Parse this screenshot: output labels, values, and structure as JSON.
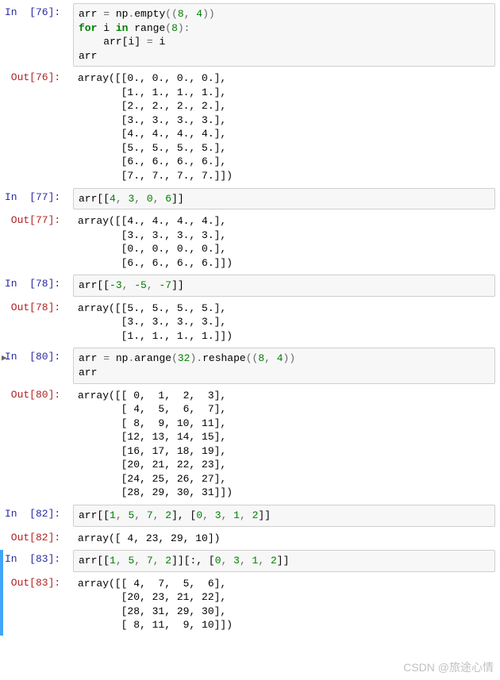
{
  "cells": {
    "c76": {
      "in_label": "In  [76]: ",
      "out_label": "Out[76]: ",
      "code_tokens": [
        [
          "arr ",
          "n"
        ],
        [
          "= ",
          "o"
        ],
        [
          "np",
          "n"
        ],
        [
          ".",
          "o"
        ],
        [
          "empty",
          "fn"
        ],
        [
          "((",
          "o"
        ],
        [
          "8",
          "num"
        ],
        [
          ", ",
          "o"
        ],
        [
          "4",
          "num"
        ],
        [
          "))",
          "o"
        ],
        [
          "\n",
          ""
        ],
        [
          "for ",
          "k"
        ],
        [
          "i ",
          "n"
        ],
        [
          "in ",
          "k"
        ],
        [
          "range",
          "fn"
        ],
        [
          "(",
          "o"
        ],
        [
          "8",
          "num"
        ],
        [
          "):",
          "o"
        ],
        [
          "\n",
          ""
        ],
        [
          "    arr[i] ",
          "n"
        ],
        [
          "= ",
          "o"
        ],
        [
          "i",
          "n"
        ],
        [
          "\n",
          ""
        ],
        [
          "arr",
          "n"
        ]
      ],
      "output": "array([[0., 0., 0., 0.],\n       [1., 1., 1., 1.],\n       [2., 2., 2., 2.],\n       [3., 3., 3., 3.],\n       [4., 4., 4., 4.],\n       [5., 5., 5., 5.],\n       [6., 6., 6., 6.],\n       [7., 7., 7., 7.]])"
    },
    "c77": {
      "in_label": "In  [77]: ",
      "out_label": "Out[77]: ",
      "code_tokens": [
        [
          "arr[[",
          "n"
        ],
        [
          "4",
          "num"
        ],
        [
          ", ",
          "o"
        ],
        [
          "3",
          "num"
        ],
        [
          ", ",
          "o"
        ],
        [
          "0",
          "num"
        ],
        [
          ", ",
          "o"
        ],
        [
          "6",
          "num"
        ],
        [
          "]]",
          "n"
        ]
      ],
      "output": "array([[4., 4., 4., 4.],\n       [3., 3., 3., 3.],\n       [0., 0., 0., 0.],\n       [6., 6., 6., 6.]])"
    },
    "c78": {
      "in_label": "In  [78]: ",
      "out_label": "Out[78]: ",
      "code_tokens": [
        [
          "arr[[",
          "n"
        ],
        [
          "-3",
          "num"
        ],
        [
          ", ",
          "o"
        ],
        [
          "-5",
          "num"
        ],
        [
          ", ",
          "o"
        ],
        [
          "-7",
          "num"
        ],
        [
          "]]",
          "n"
        ]
      ],
      "output": "array([[5., 5., 5., 5.],\n       [3., 3., 3., 3.],\n       [1., 1., 1., 1.]])"
    },
    "c80": {
      "in_label": "In  [80]: ",
      "out_label": "Out[80]: ",
      "run_marker": "▶",
      "code_tokens": [
        [
          "arr ",
          "n"
        ],
        [
          "= ",
          "o"
        ],
        [
          "np",
          "n"
        ],
        [
          ".",
          "o"
        ],
        [
          "arange",
          "fn"
        ],
        [
          "(",
          "o"
        ],
        [
          "32",
          "num"
        ],
        [
          ").",
          "o"
        ],
        [
          "reshape",
          "fn"
        ],
        [
          "((",
          "o"
        ],
        [
          "8",
          "num"
        ],
        [
          ", ",
          "o"
        ],
        [
          "4",
          "num"
        ],
        [
          "))",
          "o"
        ],
        [
          "\n",
          ""
        ],
        [
          "arr",
          "n"
        ]
      ],
      "output": "array([[ 0,  1,  2,  3],\n       [ 4,  5,  6,  7],\n       [ 8,  9, 10, 11],\n       [12, 13, 14, 15],\n       [16, 17, 18, 19],\n       [20, 21, 22, 23],\n       [24, 25, 26, 27],\n       [28, 29, 30, 31]])"
    },
    "c82": {
      "in_label": "In  [82]: ",
      "out_label": "Out[82]: ",
      "code_tokens": [
        [
          "arr[[",
          "n"
        ],
        [
          "1",
          "num"
        ],
        [
          ", ",
          "o"
        ],
        [
          "5",
          "num"
        ],
        [
          ", ",
          "o"
        ],
        [
          "7",
          "num"
        ],
        [
          ", ",
          "o"
        ],
        [
          "2",
          "num"
        ],
        [
          "], [",
          "n"
        ],
        [
          "0",
          "num"
        ],
        [
          ", ",
          "o"
        ],
        [
          "3",
          "num"
        ],
        [
          ", ",
          "o"
        ],
        [
          "1",
          "num"
        ],
        [
          ", ",
          "o"
        ],
        [
          "2",
          "num"
        ],
        [
          "]]",
          "n"
        ]
      ],
      "output": "array([ 4, 23, 29, 10])"
    },
    "c83": {
      "in_label": "In  [83]: ",
      "out_label": "Out[83]: ",
      "code_tokens": [
        [
          "arr[[",
          "n"
        ],
        [
          "1",
          "num"
        ],
        [
          ", ",
          "o"
        ],
        [
          "5",
          "num"
        ],
        [
          ", ",
          "o"
        ],
        [
          "7",
          "num"
        ],
        [
          ", ",
          "o"
        ],
        [
          "2",
          "num"
        ],
        [
          "]][:, [",
          "n"
        ],
        [
          "0",
          "num"
        ],
        [
          ", ",
          "o"
        ],
        [
          "3",
          "num"
        ],
        [
          ", ",
          "o"
        ],
        [
          "1",
          "num"
        ],
        [
          ", ",
          "o"
        ],
        [
          "2",
          "num"
        ],
        [
          "]]",
          "n"
        ]
      ],
      "output": "array([[ 4,  7,  5,  6],\n       [20, 23, 21, 22],\n       [28, 31, 29, 30],\n       [ 8, 11,  9, 10]])"
    }
  },
  "watermark": "CSDN @旅途心情"
}
